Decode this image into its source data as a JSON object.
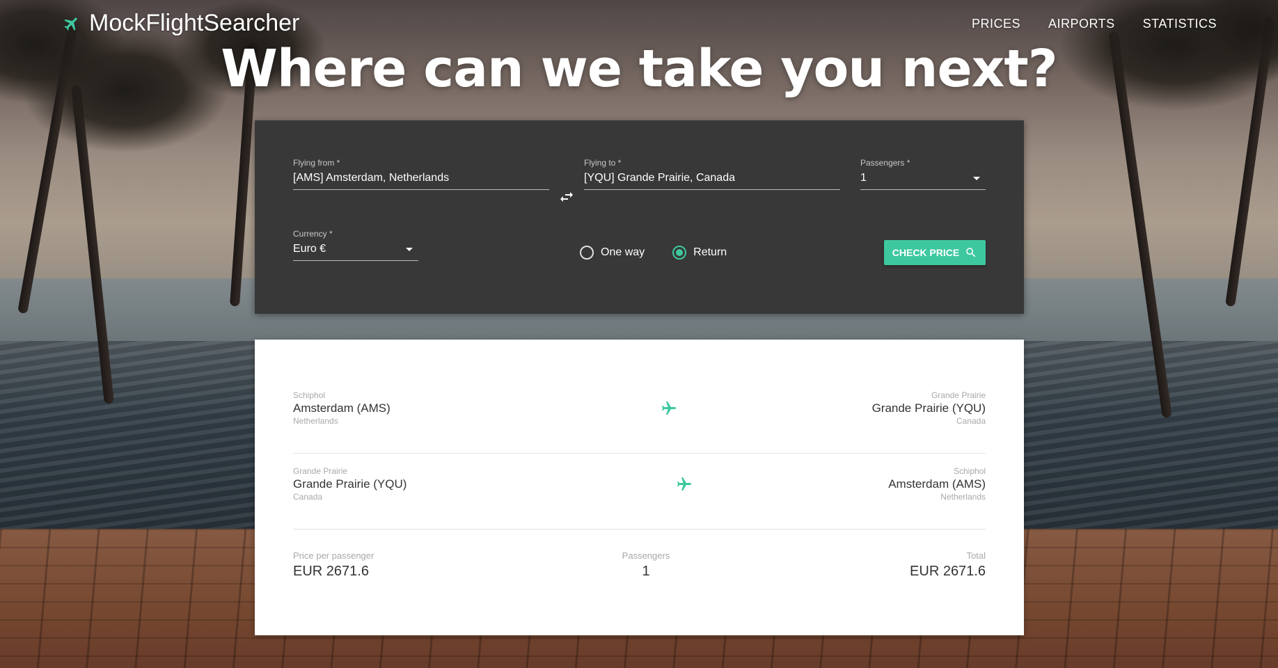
{
  "header": {
    "brand": "MockFlightSearcher",
    "nav": [
      "PRICES",
      "AIRPORTS",
      "STATISTICS"
    ]
  },
  "hero": {
    "title": "Where can we take you next?"
  },
  "search": {
    "from_label": "Flying from *",
    "from_value": "[AMS] Amsterdam, Netherlands",
    "to_label": "Flying to *",
    "to_value": "[YQU] Grande Prairie, Canada",
    "passengers_label": "Passengers *",
    "passengers_value": "1",
    "currency_label": "Currency *",
    "currency_value": "Euro €",
    "trip_options": [
      "One way",
      "Return"
    ],
    "selected_trip": "Return",
    "check_price_label": "CHECK PRICE"
  },
  "result": {
    "outbound": {
      "from_airport": "Schiphol",
      "from_city": "Amsterdam (AMS)",
      "from_country": "Netherlands",
      "to_airport": "Grande Prairie",
      "to_city": "Grande Prairie (YQU)",
      "to_country": "Canada"
    },
    "inbound": {
      "from_airport": "Grande Prairie",
      "from_city": "Grande Prairie (YQU)",
      "from_country": "Canada",
      "to_airport": "Schiphol",
      "to_city": "Amsterdam (AMS)",
      "to_country": "Netherlands"
    },
    "price_label": "Price per passenger",
    "price_value": "EUR 2671.6",
    "passengers_label": "Passengers",
    "passengers_value": "1",
    "total_label": "Total",
    "total_value": "EUR 2671.6"
  },
  "colors": {
    "accent": "#3ec8a0",
    "panel": "#383838",
    "card": "#ffffff"
  },
  "icons": {
    "brand": "airplane-icon",
    "swap": "swap-arrows-icon",
    "search": "search-icon",
    "leg": "airplane-icon"
  }
}
